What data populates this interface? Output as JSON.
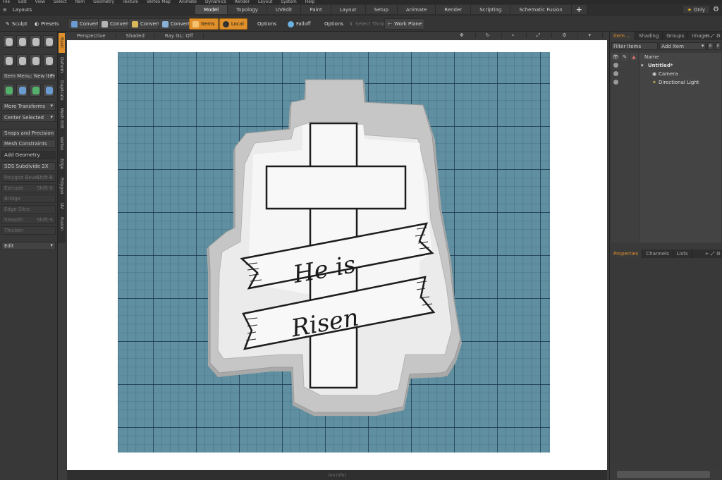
{
  "menu": [
    "File",
    "Edit",
    "View",
    "Select",
    "Item",
    "Geometry",
    "Texture",
    "Vertex Map",
    "Animate",
    "Dynamics",
    "Render",
    "Layout",
    "System",
    "Help"
  ],
  "layout_bar": {
    "layouts_label": "Layouts",
    "tabs": [
      "Model",
      "Topology",
      "UVEdit",
      "Paint",
      "Layout",
      "Setup",
      "Animate",
      "Render",
      "Scripting",
      "Schematic Fusion"
    ],
    "active_tab": "Model",
    "add_tab": "+",
    "only_label": "Only"
  },
  "toolbar": {
    "sculpt": "Sculpt",
    "presets": "Presets",
    "convert1": "Convert",
    "convert2": "Convert",
    "convert3": "Convert",
    "convert4": "Convert",
    "items": "Items",
    "local": "Local",
    "options1": "Options",
    "falloff": "Falloff",
    "options2": "Options",
    "select_through": "Select Through",
    "work_plane": "Work Plane"
  },
  "left_panel": {
    "item_menu": "Item Menu: New Item",
    "more_transforms": "More Transforms",
    "center_selected": "Center Selected",
    "snaps": "Snaps and Precision",
    "mesh_constraints": "Mesh Constraints",
    "add_geometry": "Add Geometry",
    "sds": "SDS Subdivide 2X",
    "polygon_bevel": "Polygon Bevel",
    "polygon_bevel_key": "Shift-B",
    "extrude": "Extrude",
    "extrude_key": "Shift-X",
    "bridge": "Bridge",
    "edge_slice": "Edge Slice",
    "smooth": "Smooth",
    "smooth_key": "Shift-S",
    "thicken": "Thicken",
    "edit": "Edit"
  },
  "vertical_tabs": [
    "Basic",
    "Deform",
    "Duplicate",
    "Mesh Edit",
    "Vertex",
    "Edge",
    "Polygon",
    "UV",
    "Fusion"
  ],
  "viewport_header": {
    "perspective": "Perspective",
    "shaded": "Shaded",
    "ray_gl": "Ray GL: Off"
  },
  "viewport_art": {
    "line1": "He is",
    "line2": "Risen"
  },
  "status": "(no info)",
  "right_panel": {
    "tabs": [
      "Item ...",
      "Shading",
      "Groups",
      "Images"
    ],
    "filter": "Filter Items",
    "add_item": "Add Item",
    "e_btn": "E",
    "f_btn": "F",
    "name_col": "Name",
    "items": [
      {
        "label": "Untitled*",
        "indent": 0,
        "bold": true
      },
      {
        "label": "Camera",
        "indent": 1,
        "bold": false
      },
      {
        "label": "Directional Light",
        "indent": 1,
        "bold": false
      }
    ],
    "props_tabs": [
      "Properties",
      "Channels",
      "Lists"
    ]
  },
  "colors": {
    "accent": "#e0902a",
    "grid": "#5f8fa0",
    "grid_line": "#1e3f57",
    "cutter": "#c8c8c8"
  }
}
